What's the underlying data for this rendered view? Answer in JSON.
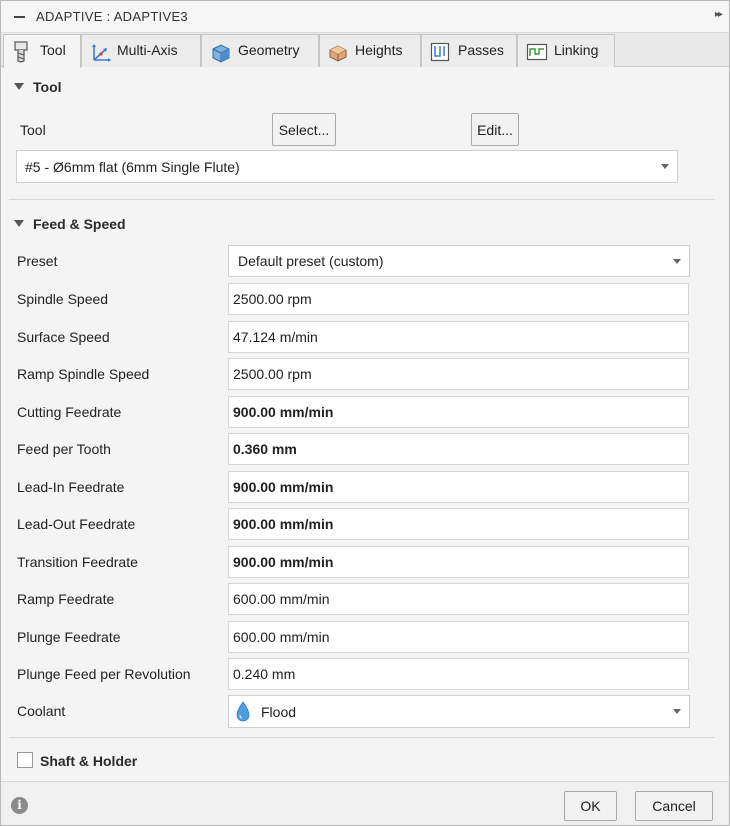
{
  "window": {
    "title": "ADAPTIVE : ADAPTIVE3"
  },
  "tabs": [
    {
      "label": "Tool",
      "icon": "end-mill-icon",
      "active": true
    },
    {
      "label": "Multi-Axis",
      "icon": "axis-icon"
    },
    {
      "label": "Geometry",
      "icon": "cube-icon"
    },
    {
      "label": "Heights",
      "icon": "heights-icon"
    },
    {
      "label": "Passes",
      "icon": "passes-icon"
    },
    {
      "label": "Linking",
      "icon": "linking-icon"
    }
  ],
  "tool_section": {
    "title": "Tool",
    "tool_label": "Tool",
    "select_label": "Select...",
    "edit_label": "Edit...",
    "tool_value": "#5 - Ø6mm flat (6mm Single Flute)"
  },
  "feed_section": {
    "title": "Feed & Speed",
    "preset_label": "Preset",
    "preset_value": "Default preset (custom)",
    "fields": [
      {
        "label": "Spindle Speed",
        "value": "2500.00 rpm",
        "bold": false
      },
      {
        "label": "Surface Speed",
        "value": "47.124 m/min",
        "bold": false
      },
      {
        "label": "Ramp Spindle Speed",
        "value": "2500.00 rpm",
        "bold": false
      },
      {
        "label": "Cutting Feedrate",
        "value": "900.00 mm/min",
        "bold": true
      },
      {
        "label": "Feed per Tooth",
        "value": "0.360 mm",
        "bold": true
      },
      {
        "label": "Lead-In Feedrate",
        "value": "900.00 mm/min",
        "bold": true
      },
      {
        "label": "Lead-Out Feedrate",
        "value": "900.00 mm/min",
        "bold": true
      },
      {
        "label": "Transition Feedrate",
        "value": "900.00 mm/min",
        "bold": true
      },
      {
        "label": "Ramp Feedrate",
        "value": "600.00 mm/min",
        "bold": false
      },
      {
        "label": "Plunge Feedrate",
        "value": "600.00 mm/min",
        "bold": false
      },
      {
        "label": "Plunge Feed per Revolution",
        "value": "0.240 mm",
        "bold": false
      }
    ],
    "coolant_label": "Coolant",
    "coolant_value": "Flood",
    "coolant_icon": "water-drop-icon"
  },
  "shaft_holder": {
    "label": "Shaft & Holder",
    "checked": false
  },
  "footer": {
    "ok_label": "OK",
    "cancel_label": "Cancel"
  },
  "colors": {
    "drop_blue": "#4a9fdc",
    "border": "#d6d6d6",
    "panel": "#f4f4f4"
  }
}
